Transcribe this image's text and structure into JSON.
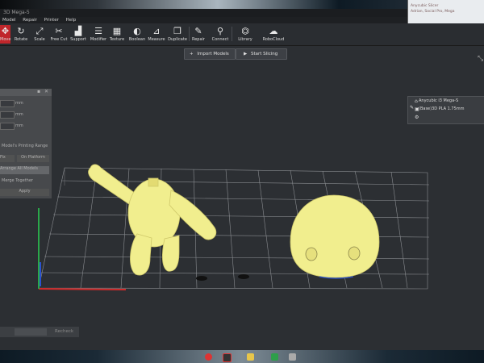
{
  "window": {
    "title": "3D Mega-5",
    "side_window_lines": [
      "Anycubic Slicer",
      "Adrian, Social Pro, Mega"
    ]
  },
  "menu": [
    "Model",
    "Repair",
    "Printer",
    "Help"
  ],
  "toolbar": {
    "tools": [
      {
        "label": "Move",
        "icon": "move-icon",
        "active": true
      },
      {
        "label": "Rotate",
        "icon": "rotate-icon"
      },
      {
        "label": "Scale",
        "icon": "scale-icon"
      },
      {
        "label": "Free Cut",
        "icon": "scissors-icon"
      },
      {
        "label": "Support",
        "icon": "support-icon"
      },
      {
        "label": "Modifier",
        "icon": "modifier-icon"
      },
      {
        "label": "Texture",
        "icon": "texture-icon"
      },
      {
        "label": "Boolean",
        "icon": "boolean-icon"
      },
      {
        "label": "Measure",
        "icon": "measure-icon"
      },
      {
        "label": "Duplicate",
        "icon": "duplicate-icon"
      },
      {
        "label": "Repair",
        "icon": "wrench-icon"
      },
      {
        "label": "Connect",
        "icon": "connect-icon"
      },
      {
        "label": "Library",
        "icon": "library-icon"
      },
      {
        "label": "RoboCloud",
        "icon": "cloud-icon"
      }
    ]
  },
  "actions": {
    "import_label": "Import Models",
    "slice_label": "Start Slicing"
  },
  "left_panel": {
    "units": [
      "mm",
      "mm",
      "mm"
    ],
    "section_label": "Model's Printing Range",
    "on_platform": "On Platform",
    "arrange_all": "Arrange All Models",
    "merge": "Merge Together",
    "apply": "Apply",
    "left_btn": "Fix",
    "bottom_label": "Recheck"
  },
  "right_panel": {
    "printer": "Anycubic i3 Mega-S",
    "filament": "(Base)3D PLA 1.75mm",
    "settings_icon": "gear-icon"
  },
  "colors": {
    "model": "#f1ee8e",
    "active_tool": "#c0262b",
    "grid": "#8a8d91",
    "axis_x": "#d02a2a",
    "axis_y": "#2aa84a",
    "axis_z": "#2a52d0"
  }
}
